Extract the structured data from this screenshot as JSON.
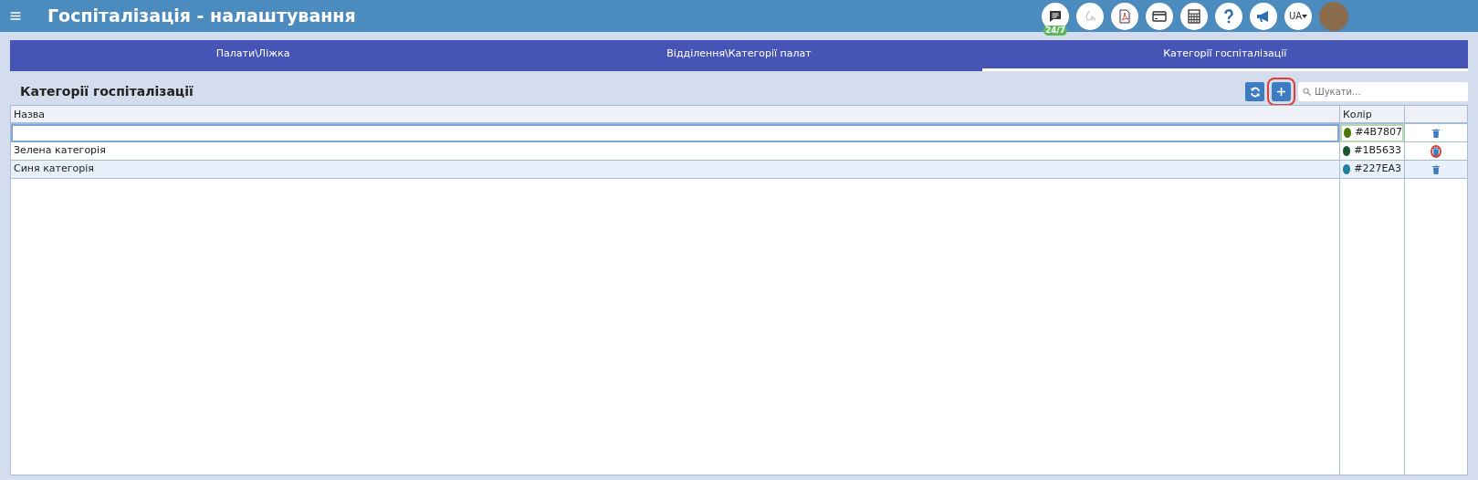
{
  "header": {
    "title": "Госпіталізація - налаштування",
    "chat_badge": "24/7",
    "language": "UA"
  },
  "tabs": [
    {
      "label": "Палати\\Ліжка",
      "selected": false
    },
    {
      "label": "Відділення\\Категорії палат",
      "selected": false
    },
    {
      "label": "Категорії госпіталізації",
      "selected": true
    }
  ],
  "section_title": "Категорії госпіталізації",
  "toolbar": {
    "add_highlighted": true,
    "search": {
      "placeholder": "Шукати..."
    }
  },
  "table": {
    "columns": [
      "Назва",
      "Колір"
    ],
    "rows": [
      {
        "kind": "edit",
        "name": "",
        "color": "#4b7807",
        "color_label": "#4B7807",
        "delete_highlighted": false
      },
      {
        "kind": "view",
        "name": "Зелена категорія",
        "color": "#1b5633",
        "color_label": "#1B5633",
        "delete_highlighted": true
      },
      {
        "kind": "view",
        "name": "Синя категорія",
        "color": "#227ea3",
        "color_label": "#227EA3",
        "delete_highlighted": false
      }
    ]
  }
}
